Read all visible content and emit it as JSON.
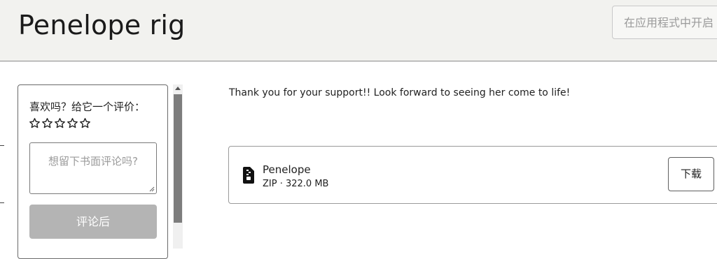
{
  "header": {
    "title": "Penelope rig",
    "open_in_app_label": "在应用程式中开启"
  },
  "review": {
    "prompt": "喜欢吗？给它一个评价：",
    "rating": 0,
    "rating_max": 5,
    "comment_placeholder": "想留下书面评论吗?",
    "submit_label": "评论后"
  },
  "main": {
    "message": "Thank you for your support!! Look forward to seeing her come to life!",
    "file": {
      "icon": "zip-file-icon",
      "name": "Penelope",
      "meta": "ZIP · 322.0 MB",
      "download_label": "下载"
    }
  }
}
